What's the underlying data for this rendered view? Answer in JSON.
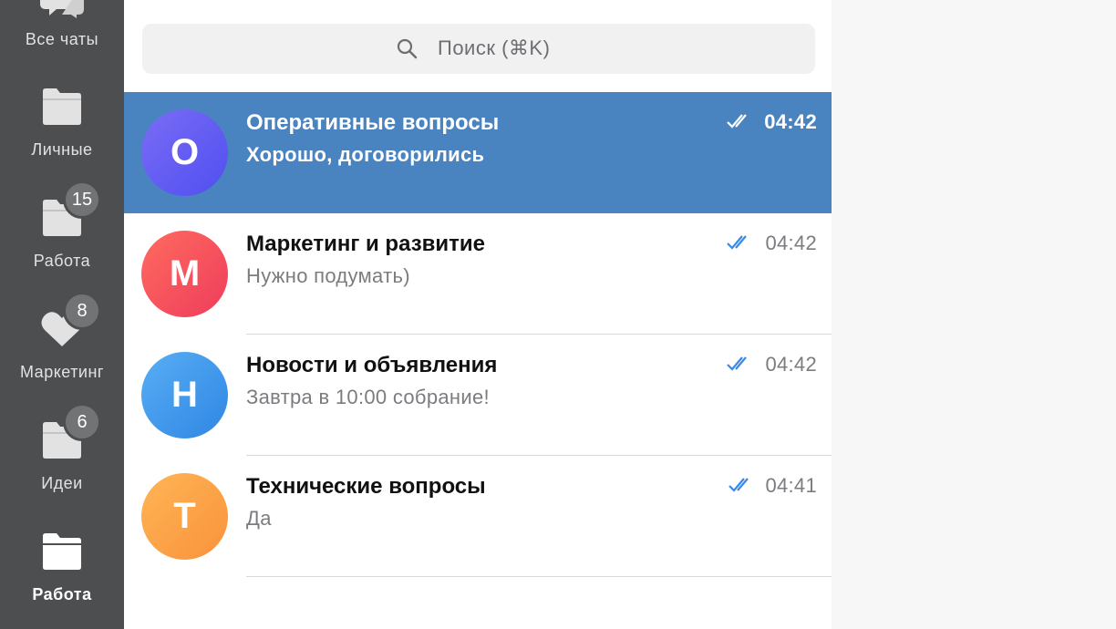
{
  "sidebar": {
    "folders": [
      {
        "label": "Все чаты",
        "icon": "chat-bubbles-icon",
        "badge": ""
      },
      {
        "label": "Личные",
        "icon": "folder-icon",
        "badge": ""
      },
      {
        "label": "Работа",
        "icon": "folder-icon",
        "badge": "15"
      },
      {
        "label": "Маркетинг",
        "icon": "heart-icon",
        "badge": "8"
      },
      {
        "label": "Идеи",
        "icon": "folder-icon",
        "badge": "6"
      },
      {
        "label": "Работа",
        "icon": "folder-icon",
        "badge": "",
        "active": true
      }
    ]
  },
  "search": {
    "placeholder": "Поиск (⌘K)",
    "icon": "search-icon"
  },
  "chats": [
    {
      "initial": "О",
      "title": "Оперативные вопросы",
      "preview": "Хорошо, договорились",
      "time": "04:42",
      "status": "read",
      "selected": true,
      "color": "#5c5cf0"
    },
    {
      "initial": "М",
      "title": "Маркетинг и развитие",
      "preview": "Нужно подумать)",
      "time": "04:42",
      "status": "read",
      "selected": false,
      "color": "#f0505a"
    },
    {
      "initial": "Н",
      "title": "Новости и объявления",
      "preview": "Завтра в 10:00 собрание!",
      "time": "04:42",
      "status": "read",
      "selected": false,
      "color": "#3e95e8"
    },
    {
      "initial": "Т",
      "title": "Технические вопросы",
      "preview": "Да",
      "time": "04:41",
      "status": "read",
      "selected": false,
      "color": "#fb9e45"
    }
  ],
  "colors": {
    "sidebar_bg": "#4d4e50",
    "selected_row": "#4a84c0",
    "check_blue": "#3a88e6"
  }
}
